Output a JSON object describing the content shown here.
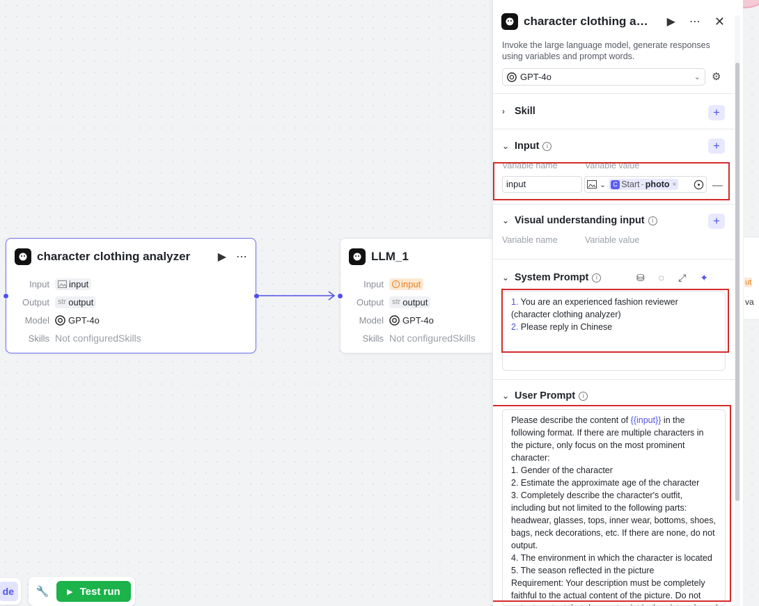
{
  "canvas": {
    "node1": {
      "title": "character clothing analyzer",
      "rows": [
        {
          "label": "Input",
          "prefix": "",
          "value": "input"
        },
        {
          "label": "Output",
          "prefix": "str",
          "value": "output"
        },
        {
          "label": "Model",
          "prefix": "",
          "value": "GPT-4o"
        },
        {
          "label": "Skills",
          "prefix": "",
          "value": "Not configuredSkills"
        }
      ]
    },
    "node2": {
      "title": "LLM_1",
      "rows": [
        {
          "label": "Input",
          "prefix": "",
          "value": "input"
        },
        {
          "label": "Output",
          "prefix": "str",
          "value": "output"
        },
        {
          "label": "Model",
          "prefix": "",
          "value": "GPT-4o"
        },
        {
          "label": "Skills",
          "prefix": "",
          "value": "Not configuredSkills"
        }
      ]
    },
    "peek": {
      "tag": "ut",
      "text": "va"
    }
  },
  "toolbar": {
    "left_chip": "de",
    "test_run_label": "Test run"
  },
  "panel": {
    "title": "character clothing analyzer",
    "description": "Invoke the large language model, generate responses using variables and prompt words.",
    "model": "GPT-4o",
    "sections": {
      "skill": "Skill",
      "input": "Input",
      "visual": "Visual understanding input",
      "system": "System Prompt",
      "user": "User Prompt"
    },
    "columns": {
      "name": "Variable name",
      "value": "Variable value"
    },
    "input_row": {
      "name": "input",
      "source_node": "Start",
      "source_sep": " - ",
      "source_var": "photo"
    },
    "system_prompt": [
      {
        "num": "1.",
        "text": " You are an experienced fashion reviewer (character clothing analyzer)"
      },
      {
        "num": "2.",
        "text": " Please reply in Chinese"
      }
    ],
    "user_prompt": {
      "before_var": "Please describe the content of ",
      "var": "{{input}}",
      "after_var": " in the following format. If there are multiple characters in the picture, only focus on the most prominent character:",
      "lines": [
        "1. Gender of the character",
        "2. Estimate the approximate age of the character",
        "3. Completely describe the character's outfit, including but not limited to the following parts: headwear, glasses, tops, inner wear, bottoms, shoes, bags, neck decorations, etc. If there are none, do not output.",
        "4. The environment in which the character is located",
        "5. The season reflected in the picture",
        "Requirement: Your description must be completely faithful to the actual content of the picture. Do not output content that does not exist in the picture based on your imagination."
      ]
    }
  }
}
